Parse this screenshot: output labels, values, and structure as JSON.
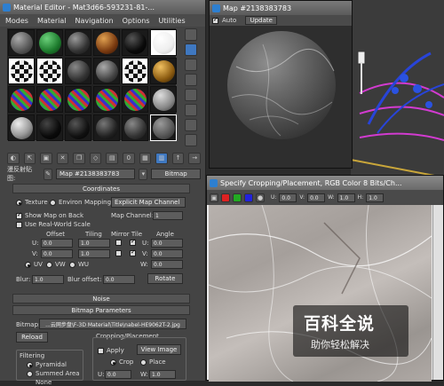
{
  "material_editor": {
    "title": "Material Editor - Mat3d66-593231-81-...",
    "menu": [
      "Modes",
      "Material",
      "Navigation",
      "Options",
      "Utilities"
    ],
    "material_label": "漫反射贴图:",
    "map_name": "Map #2138383783",
    "map_type": "Bitmap",
    "coordinates": {
      "header": "Coordinates",
      "texture": "Texture",
      "environ": "Environ",
      "mapping_label": "Mapping:",
      "mapping_value": "Explicit Map Channel",
      "show_map_on_back": "Show Map on Back",
      "map_channel_label": "Map Channel:",
      "map_channel_value": "1",
      "real_world": "Use Real-World Scale",
      "col_offset": "Offset",
      "col_tiling": "Tiling",
      "col_mirror_tile": "Mirror Tile",
      "col_angle": "Angle",
      "u_label": "U:",
      "v_label": "V:",
      "w_label": "W:",
      "u_offset": "0.0",
      "u_tiling": "1.0",
      "u_angle": "0.0",
      "v_offset": "0.0",
      "v_tiling": "1.0",
      "v_angle": "0.0",
      "w_angle": "0.0",
      "uv": "UV",
      "vw": "VW",
      "wu": "WU",
      "blur_label": "Blur:",
      "blur_value": "1.0",
      "blur_offset_label": "Blur offset:",
      "blur_offset_value": "0.0",
      "rotate": "Rotate"
    },
    "noise_header": "Noise",
    "bitmap": {
      "header": "Bitmap Parameters",
      "bitmap_label": "Bitmap:",
      "bitmap_path": "...云网步盘\\F-3D Material\\Title\\nabel-HE9062T-2.jpg",
      "reload": "Reload",
      "cropping_header": "Cropping/Placement",
      "apply": "Apply",
      "view_image": "View Image",
      "crop": "Crop",
      "place": "Place",
      "filtering_header": "Filtering",
      "pyramidal": "Pyramidal",
      "summed_area": "Summed Area",
      "none": "None",
      "u_crop": "0.0",
      "w_crop": "1.0"
    },
    "side_tools": [
      "sample-type-icon",
      "backlight-icon",
      "background-icon",
      "uv-tiling-icon",
      "video-check-icon",
      "make-preview-icon",
      "options-icon",
      "select-by-material-icon",
      "material-map-navigator-icon"
    ],
    "bottom_tools": [
      "get-material-icon",
      "put-to-scene-icon",
      "assign-icon",
      "reset-icon",
      "copy-icon",
      "unique-icon",
      "put-to-library-icon",
      "material-id-icon",
      "show-map-icon",
      "show-end-result-icon",
      "go-parent-icon",
      "go-sibling-icon"
    ]
  },
  "map_window": {
    "title": "Map #2138383783",
    "auto_label": "Auto",
    "update_label": "Update"
  },
  "crop_window": {
    "title": "Specify Cropping/Placement, RGB Color 8 Bits/Ch...",
    "u_label": "U:",
    "u_value": "0.0",
    "v_label": "V:",
    "v_value": "0.0",
    "w_label": "W:",
    "w_value": "1.0",
    "h_label": "H:",
    "h_value": "1.0"
  },
  "watermark": {
    "title": "百科全说",
    "subtitle": "助你轻松解决"
  }
}
